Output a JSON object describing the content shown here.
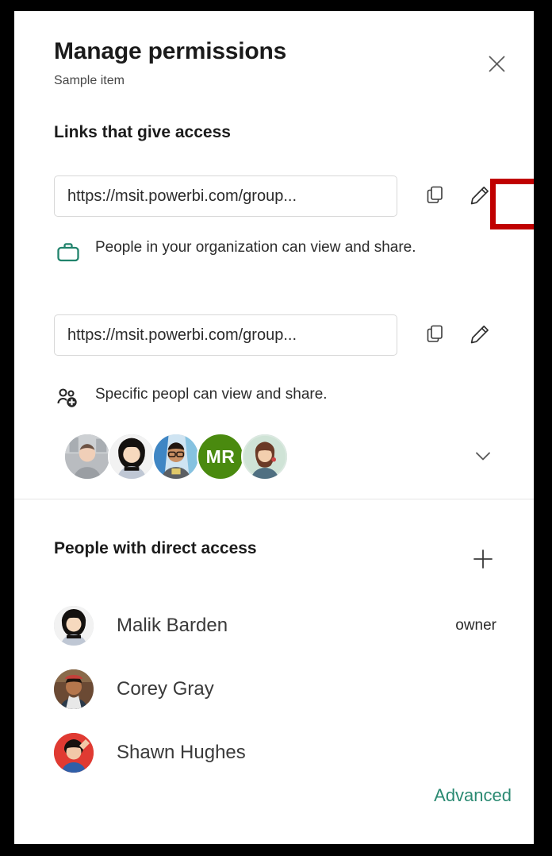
{
  "dialog": {
    "title": "Manage permissions",
    "subtitle": "Sample item",
    "close_icon": "close-icon"
  },
  "links_section": {
    "heading": "Links that give access",
    "links": [
      {
        "url": "https://msit.powerbi.com/group...",
        "description": "People in your organization can view and share.",
        "scope_icon": "briefcase-icon",
        "scope_icon_color": "#21836c",
        "copy_icon": "copy-icon",
        "edit_icon": "pencil-icon",
        "highlighted": true
      },
      {
        "url": "https://msit.powerbi.com/group...",
        "description": "Specific peopl can view and share.",
        "scope_icon": "people-add-icon",
        "scope_icon_color": "#262626",
        "copy_icon": "copy-icon",
        "edit_icon": "pencil-icon",
        "highlighted": false
      }
    ],
    "shared_avatars": [
      {
        "type": "photo",
        "name": "avatar-1"
      },
      {
        "type": "photo",
        "name": "avatar-2"
      },
      {
        "type": "photo",
        "name": "avatar-3"
      },
      {
        "type": "initials",
        "initials": "MR",
        "color": "#4a8a0f"
      },
      {
        "type": "photo",
        "name": "avatar-5"
      }
    ],
    "expand_icon": "chevron-down-icon"
  },
  "direct_access_section": {
    "heading": "People with direct access",
    "add_icon": "plus-icon",
    "people": [
      {
        "name": "Malik Barden",
        "role": "owner"
      },
      {
        "name": "Corey Gray",
        "role": ""
      },
      {
        "name": "Shawn Hughes",
        "role": ""
      }
    ]
  },
  "footer": {
    "advanced_label": "Advanced",
    "advanced_color": "#2b8a72"
  },
  "annotation": {
    "highlight_color": "#c00000"
  }
}
